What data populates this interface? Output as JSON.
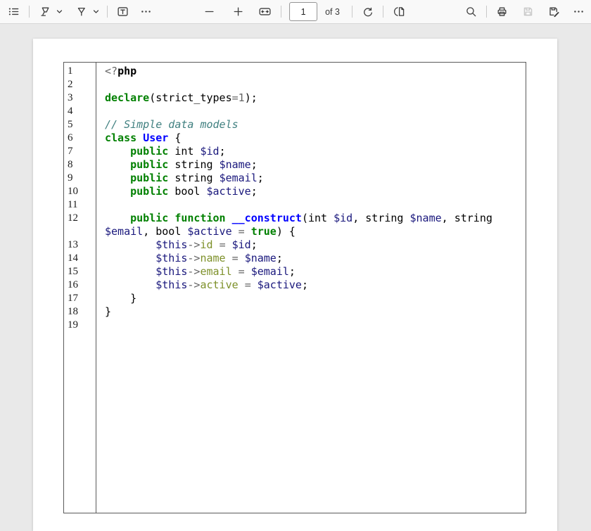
{
  "toolbar": {
    "center": {
      "page_value": "1",
      "of_label": "of 3"
    }
  },
  "colors": {
    "plain": "#000000",
    "keyword": "#008000",
    "class_name": "#0000FF",
    "function_name": "#0000FF",
    "variable": "#19177C",
    "property": "#7D9029",
    "operator": "#666666",
    "number": "#666666",
    "comment": "#408080",
    "toolbar_bg": "#f9f9f9",
    "canvas_bg": "#e9e9e9",
    "code_border": "#5a5a5a"
  },
  "icons": {
    "left": [
      "outline-icon",
      "highlighter-icon",
      "chevron-down-icon",
      "pen-icon",
      "chevron-down-icon",
      "text-box-icon",
      "more-icon"
    ],
    "center": [
      "zoom-out-icon",
      "zoom-in-icon",
      "fit-width-icon",
      "rotate-icon",
      "page-view-icon"
    ],
    "right": [
      "search-icon",
      "print-icon",
      "save-icon",
      "save-as-icon",
      "more-icon"
    ]
  },
  "document": {
    "language": "php",
    "code": {
      "rows": [
        {
          "n": "1",
          "spans": [
            {
              "t": "<?",
              "s": "op"
            },
            {
              "t": "php",
              "s": "b"
            }
          ]
        },
        {
          "n": "2",
          "spans": []
        },
        {
          "n": "3",
          "spans": [
            {
              "t": "declare",
              "s": "kw"
            },
            {
              "t": "(strict_types",
              "s": "p"
            },
            {
              "t": "=",
              "s": "op"
            },
            {
              "t": "1",
              "s": "num"
            },
            {
              "t": ");",
              "s": "p"
            }
          ]
        },
        {
          "n": "4",
          "spans": []
        },
        {
          "n": "5",
          "spans": [
            {
              "t": "// Simple data models",
              "s": "com"
            }
          ]
        },
        {
          "n": "6",
          "spans": [
            {
              "t": "class",
              "s": "kw"
            },
            {
              "t": " ",
              "s": "p"
            },
            {
              "t": "User",
              "s": "cls"
            },
            {
              "t": " {",
              "s": "p"
            }
          ]
        },
        {
          "n": "7",
          "spans": [
            {
              "t": "    ",
              "s": "p"
            },
            {
              "t": "public",
              "s": "kw"
            },
            {
              "t": " int ",
              "s": "p"
            },
            {
              "t": "$id",
              "s": "var"
            },
            {
              "t": ";",
              "s": "p"
            }
          ]
        },
        {
          "n": "8",
          "spans": [
            {
              "t": "    ",
              "s": "p"
            },
            {
              "t": "public",
              "s": "kw"
            },
            {
              "t": " string ",
              "s": "p"
            },
            {
              "t": "$name",
              "s": "var"
            },
            {
              "t": ";",
              "s": "p"
            }
          ]
        },
        {
          "n": "9",
          "spans": [
            {
              "t": "    ",
              "s": "p"
            },
            {
              "t": "public",
              "s": "kw"
            },
            {
              "t": " string ",
              "s": "p"
            },
            {
              "t": "$email",
              "s": "var"
            },
            {
              "t": ";",
              "s": "p"
            }
          ]
        },
        {
          "n": "10",
          "spans": [
            {
              "t": "    ",
              "s": "p"
            },
            {
              "t": "public",
              "s": "kw"
            },
            {
              "t": " bool ",
              "s": "p"
            },
            {
              "t": "$active",
              "s": "var"
            },
            {
              "t": ";",
              "s": "p"
            }
          ]
        },
        {
          "n": "11",
          "spans": []
        },
        {
          "n": "12",
          "spans": [
            {
              "t": "    ",
              "s": "p"
            },
            {
              "t": "public",
              "s": "kw"
            },
            {
              "t": " ",
              "s": "p"
            },
            {
              "t": "function",
              "s": "kw"
            },
            {
              "t": " ",
              "s": "p"
            },
            {
              "t": "__construct",
              "s": "fn"
            },
            {
              "t": "(int ",
              "s": "p"
            },
            {
              "t": "$id",
              "s": "var"
            },
            {
              "t": ", string ",
              "s": "p"
            },
            {
              "t": "$name",
              "s": "var"
            },
            {
              "t": ", string",
              "s": "p"
            }
          ]
        },
        {
          "n": "",
          "spans": [
            {
              "t": "$email",
              "s": "var"
            },
            {
              "t": ", bool ",
              "s": "p"
            },
            {
              "t": "$active",
              "s": "var"
            },
            {
              "t": " ",
              "s": "p"
            },
            {
              "t": "=",
              "s": "op"
            },
            {
              "t": " ",
              "s": "p"
            },
            {
              "t": "true",
              "s": "kw"
            },
            {
              "t": ") {",
              "s": "p"
            }
          ]
        },
        {
          "n": "13",
          "spans": [
            {
              "t": "        ",
              "s": "p"
            },
            {
              "t": "$this",
              "s": "var"
            },
            {
              "t": "->",
              "s": "op"
            },
            {
              "t": "id",
              "s": "prop"
            },
            {
              "t": " ",
              "s": "p"
            },
            {
              "t": "=",
              "s": "op"
            },
            {
              "t": " ",
              "s": "p"
            },
            {
              "t": "$id",
              "s": "var"
            },
            {
              "t": ";",
              "s": "p"
            }
          ]
        },
        {
          "n": "14",
          "spans": [
            {
              "t": "        ",
              "s": "p"
            },
            {
              "t": "$this",
              "s": "var"
            },
            {
              "t": "->",
              "s": "op"
            },
            {
              "t": "name",
              "s": "prop"
            },
            {
              "t": " ",
              "s": "p"
            },
            {
              "t": "=",
              "s": "op"
            },
            {
              "t": " ",
              "s": "p"
            },
            {
              "t": "$name",
              "s": "var"
            },
            {
              "t": ";",
              "s": "p"
            }
          ]
        },
        {
          "n": "15",
          "spans": [
            {
              "t": "        ",
              "s": "p"
            },
            {
              "t": "$this",
              "s": "var"
            },
            {
              "t": "->",
              "s": "op"
            },
            {
              "t": "email",
              "s": "prop"
            },
            {
              "t": " ",
              "s": "p"
            },
            {
              "t": "=",
              "s": "op"
            },
            {
              "t": " ",
              "s": "p"
            },
            {
              "t": "$email",
              "s": "var"
            },
            {
              "t": ";",
              "s": "p"
            }
          ]
        },
        {
          "n": "16",
          "spans": [
            {
              "t": "        ",
              "s": "p"
            },
            {
              "t": "$this",
              "s": "var"
            },
            {
              "t": "->",
              "s": "op"
            },
            {
              "t": "active",
              "s": "prop"
            },
            {
              "t": " ",
              "s": "p"
            },
            {
              "t": "=",
              "s": "op"
            },
            {
              "t": " ",
              "s": "p"
            },
            {
              "t": "$active",
              "s": "var"
            },
            {
              "t": ";",
              "s": "p"
            }
          ]
        },
        {
          "n": "17",
          "spans": [
            {
              "t": "    }",
              "s": "p"
            }
          ]
        },
        {
          "n": "18",
          "spans": [
            {
              "t": "}",
              "s": "p"
            }
          ]
        },
        {
          "n": "19",
          "spans": []
        }
      ]
    }
  }
}
